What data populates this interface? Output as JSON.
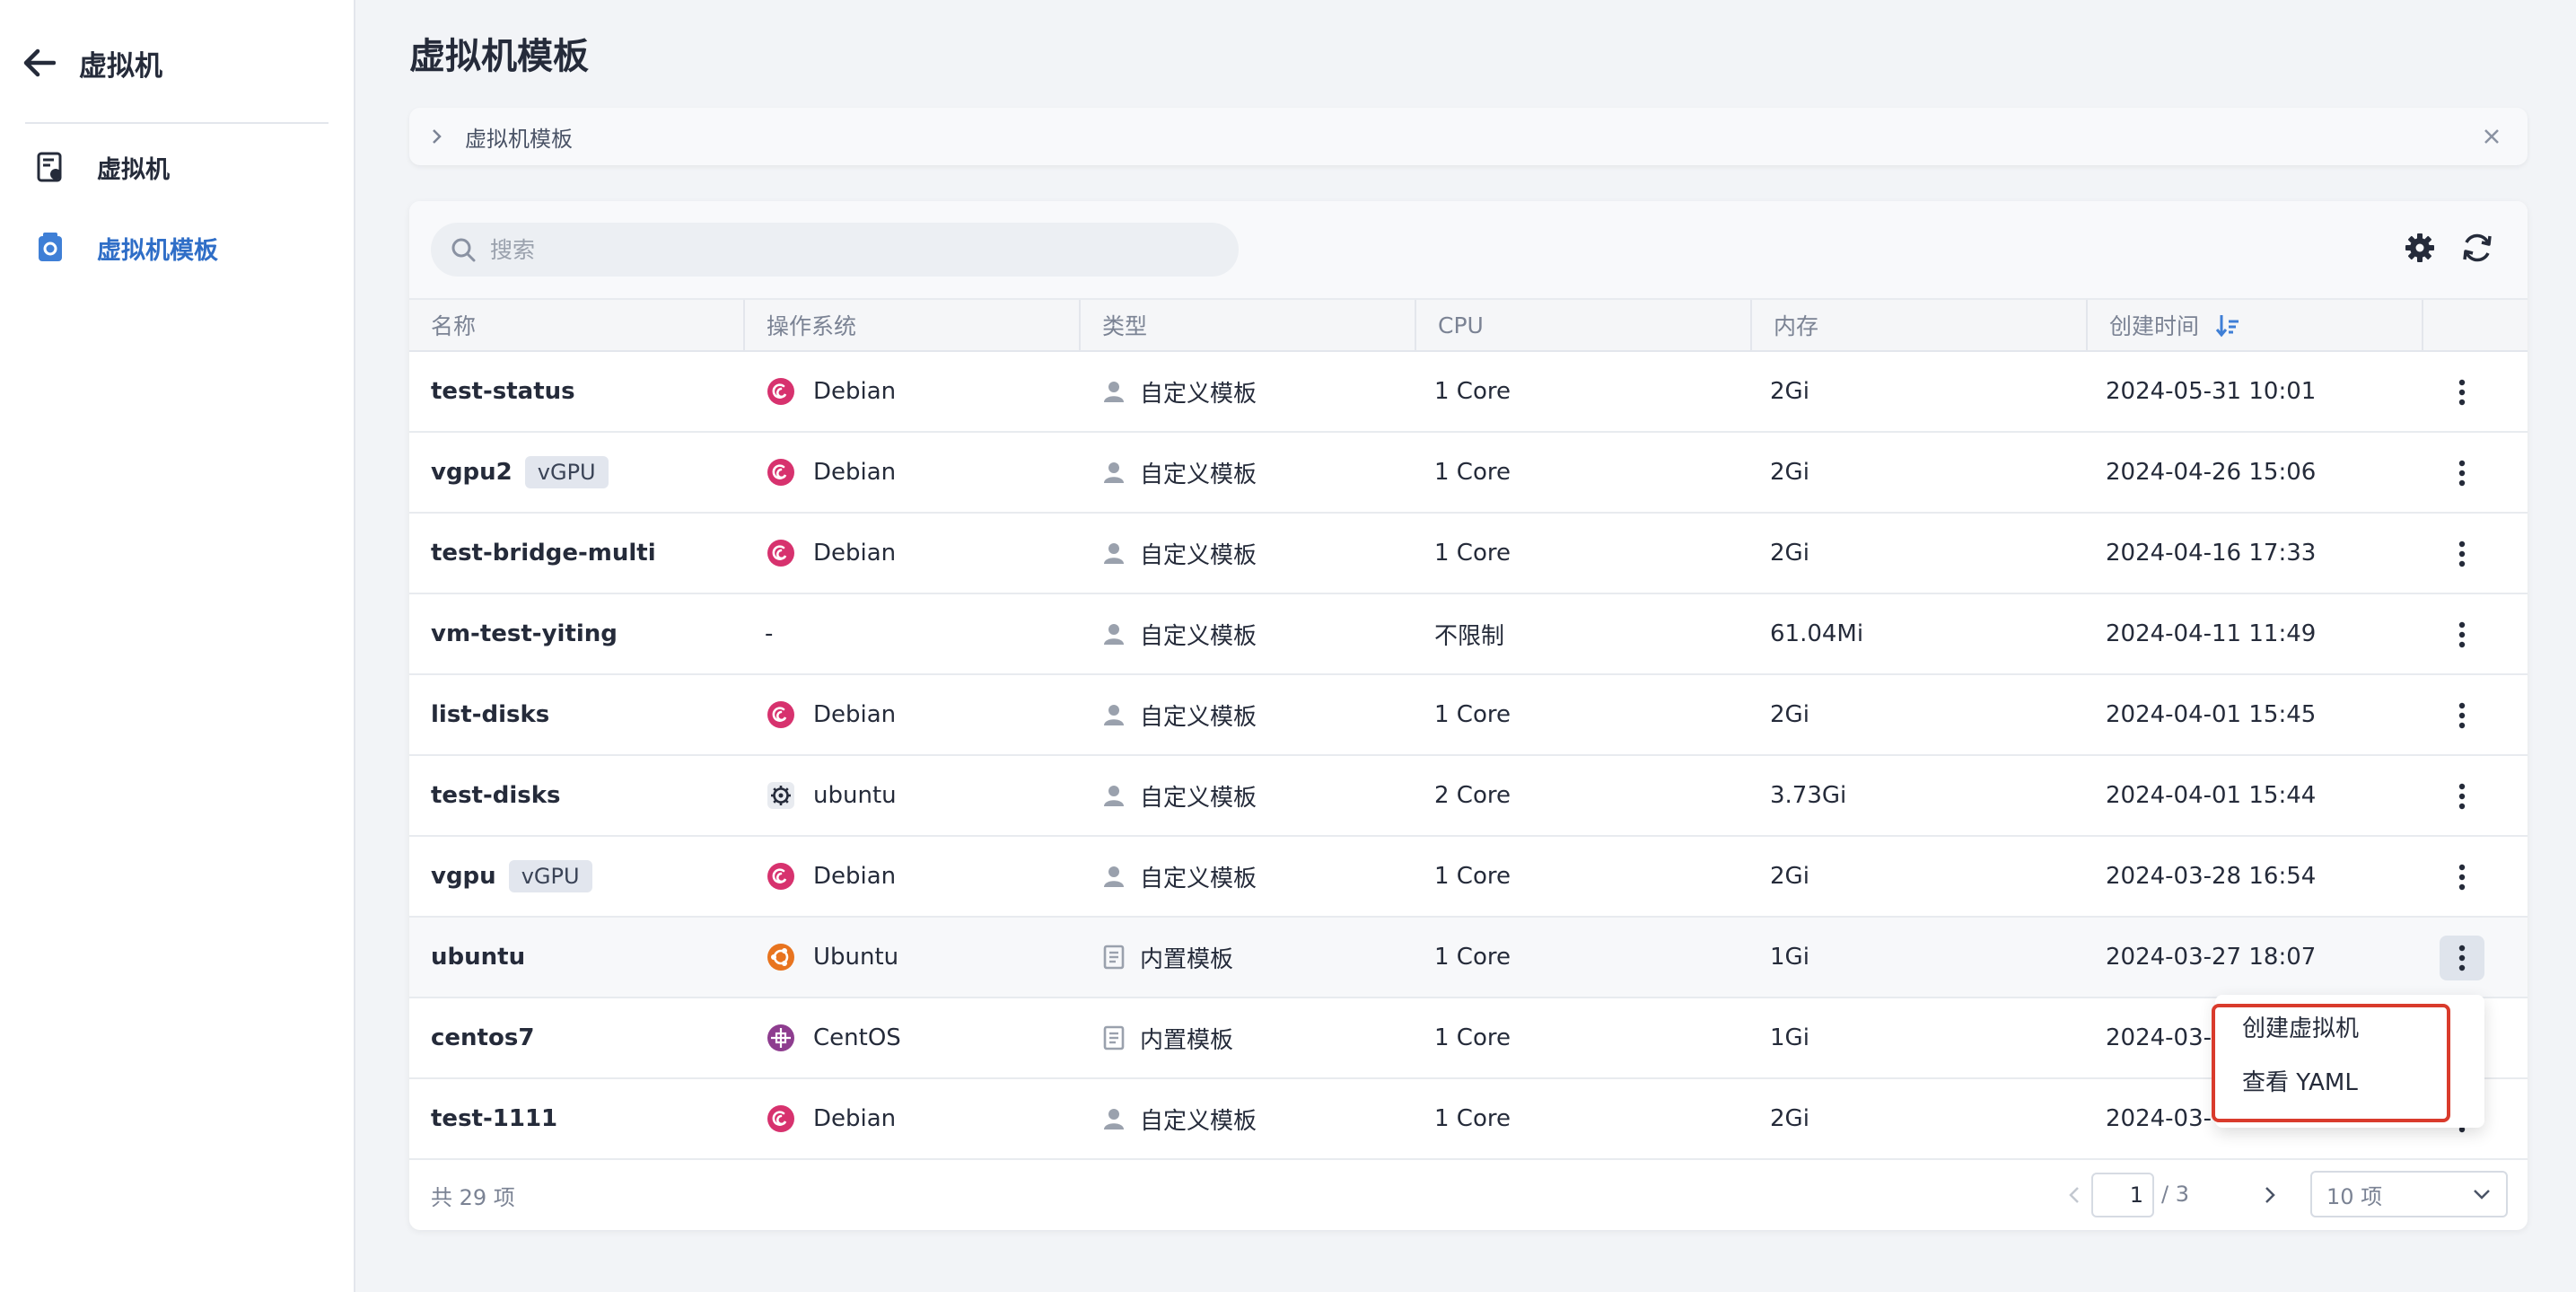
{
  "sidebar": {
    "title": "虚拟机",
    "items": [
      {
        "label": "虚拟机",
        "active": false,
        "icon": "vm-icon"
      },
      {
        "label": "虚拟机模板",
        "active": true,
        "icon": "template-icon"
      }
    ]
  },
  "page": {
    "title": "虚拟机模板",
    "breadcrumb": "虚拟机模板"
  },
  "search": {
    "placeholder": "搜索",
    "value": ""
  },
  "table": {
    "columns": [
      "名称",
      "操作系统",
      "类型",
      "CPU",
      "内存",
      "创建时间"
    ],
    "sort_column": "创建时间",
    "rows": [
      {
        "name": "test-status",
        "tag": "",
        "os": "Debian",
        "os_icon": "debian-icon",
        "type": "自定义模板",
        "cpu": "1 Core",
        "memory": "2Gi",
        "created": "2024-05-31 10:01"
      },
      {
        "name": "vgpu2",
        "tag": "vGPU",
        "os": "Debian",
        "os_icon": "debian-icon",
        "type": "自定义模板",
        "cpu": "1 Core",
        "memory": "2Gi",
        "created": "2024-04-26 15:06"
      },
      {
        "name": "test-bridge-multi",
        "tag": "",
        "os": "Debian",
        "os_icon": "debian-icon",
        "type": "自定义模板",
        "cpu": "1 Core",
        "memory": "2Gi",
        "created": "2024-04-16 17:33"
      },
      {
        "name": "vm-test-yiting",
        "tag": "",
        "os": "-",
        "os_icon": "",
        "type": "自定义模板",
        "cpu": "不限制",
        "memory": "61.04Mi",
        "created": "2024-04-11 11:49"
      },
      {
        "name": "list-disks",
        "tag": "",
        "os": "Debian",
        "os_icon": "debian-icon",
        "type": "自定义模板",
        "cpu": "1 Core",
        "memory": "2Gi",
        "created": "2024-04-01 15:45"
      },
      {
        "name": "test-disks",
        "tag": "",
        "os": "ubuntu",
        "os_icon": "gear-os-icon",
        "type": "自定义模板",
        "cpu": "2 Core",
        "memory": "3.73Gi",
        "created": "2024-04-01 15:44"
      },
      {
        "name": "vgpu",
        "tag": "vGPU",
        "os": "Debian",
        "os_icon": "debian-icon",
        "type": "自定义模板",
        "cpu": "1 Core",
        "memory": "2Gi",
        "created": "2024-03-28 16:54"
      },
      {
        "name": "ubuntu",
        "tag": "",
        "os": "Ubuntu",
        "os_icon": "ubuntu-icon",
        "type": "内置模板",
        "cpu": "1 Core",
        "memory": "1Gi",
        "created": "2024-03-27 18:07"
      },
      {
        "name": "centos7",
        "tag": "",
        "os": "CentOS",
        "os_icon": "centos-icon",
        "type": "内置模板",
        "cpu": "1 Core",
        "memory": "1Gi",
        "created": "2024-03-"
      },
      {
        "name": "test-1111",
        "tag": "",
        "os": "Debian",
        "os_icon": "debian-icon",
        "type": "自定义模板",
        "cpu": "1 Core",
        "memory": "2Gi",
        "created": "2024-03-"
      }
    ]
  },
  "footer": {
    "total": "共 29 项",
    "page": "1",
    "page_total": "/ 3",
    "page_size": "10 项"
  },
  "menu": {
    "items": [
      "创建虚拟机",
      "查看 YAML"
    ]
  },
  "colors": {
    "accent": "#2f6ec7",
    "debian": "#d7326e",
    "ubuntu": "#e8741f",
    "centos": "#8e3d8f",
    "highlight": "#d93b2c"
  }
}
